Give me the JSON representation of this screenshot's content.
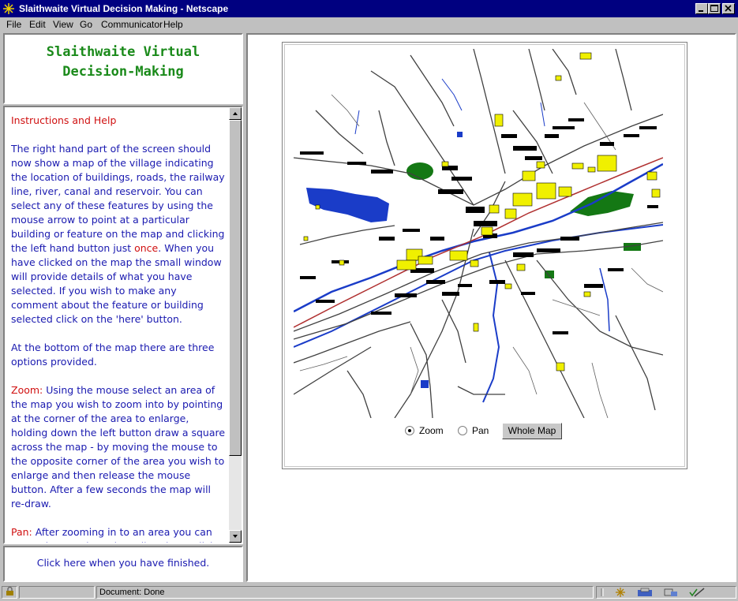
{
  "window": {
    "title": "Slaithwaite Virtual Decision Making - Netscape"
  },
  "menu": [
    "File",
    "Edit",
    "View",
    "Go",
    "Communicator",
    "Help"
  ],
  "brand": {
    "line1": "Slaithwaite Virtual",
    "line2": "Decision-Making"
  },
  "help": {
    "heading": "Instructions and Help",
    "p1_a": "The right hand part of the screen should now show a map of the village indicating the location of buildings, roads, the railway line, river, canal and reservoir. You can select any of these features by using the mouse arrow to point at a particular building or feature on the map and clicking the left hand button just ",
    "p1_once": "once",
    "p1_b": ". When you have clicked on the map the small window will provide details of what you have selected. If you wish to make any comment about the feature or building selected click on the 'here' button.",
    "p2": "At the bottom of the map there are three options provided.",
    "zoom_label": "Zoom:",
    "zoom_text": " Using the mouse select an area of the map you wish to zoom into by pointing at the corner of the area to enlarge, holding down the left button draw a square across the map - by moving the mouse to the opposite corner of the area you wish to enlarge and then release the mouse button. After a few seconds the map will re-draw.",
    "pan_label": "Pan:",
    "pan_text": " After zooming in to an area you can move the map in various directions. Click on"
  },
  "finish": {
    "text": "Click here when you have finished."
  },
  "map_controls": {
    "zoom_label": "Zoom",
    "pan_label": "Pan",
    "selected": "Zoom",
    "whole_map_label": "Whole Map"
  },
  "status": {
    "text": "Document: Done"
  },
  "colors": {
    "water": "#1a3cc8",
    "park": "#147814",
    "building": "#f0f000",
    "title_bar": "#000080"
  }
}
